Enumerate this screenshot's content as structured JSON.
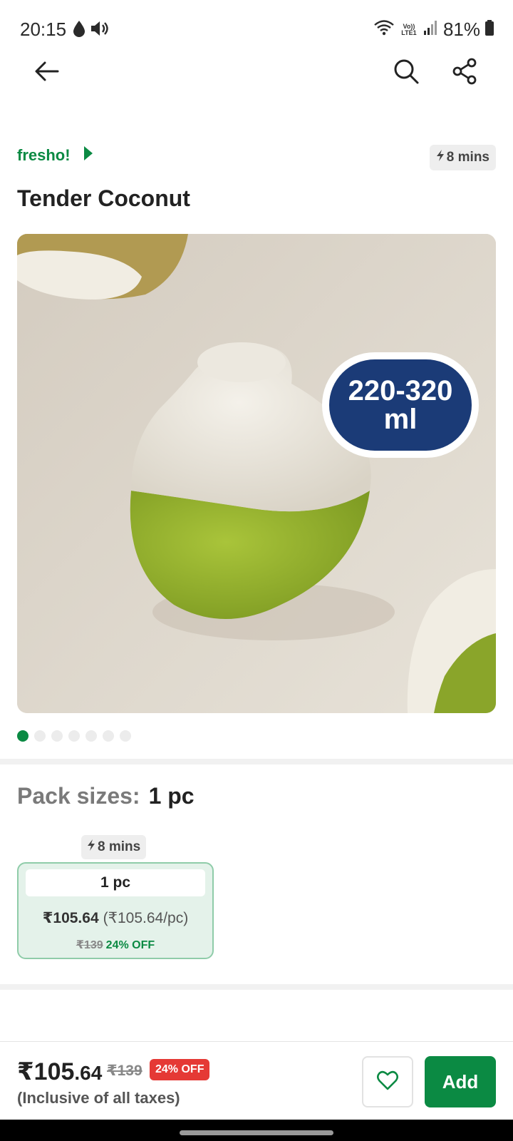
{
  "status_bar": {
    "time": "20:15",
    "battery": "81%",
    "network_label": "Vo)) LTE1",
    "icons": [
      "drop-icon",
      "volume-icon",
      "wifi-icon",
      "signal-icon",
      "battery-icon"
    ]
  },
  "app_bar": {
    "icons": [
      "back-arrow-icon",
      "search-icon",
      "share-icon"
    ]
  },
  "product": {
    "brand": "fresho!",
    "delivery_time": "8 mins",
    "title": "Tender Coconut",
    "image": {
      "volume_badge_line1": "220-320",
      "volume_badge_line2": "ml",
      "badge_color": "#1b3b77",
      "total_images": 7,
      "active_image": 1
    }
  },
  "pack_sizes": {
    "label": "Pack sizes:",
    "selected": "1 pc",
    "options": [
      {
        "delivery_time": "8 mins",
        "size": "1 pc",
        "price": "₹105.64",
        "unit_price": "(₹105.64/pc)",
        "mrp": "₹139",
        "discount": "24% OFF"
      }
    ]
  },
  "bottom_bar": {
    "price_main": "₹105",
    "price_decimal": ".64",
    "mrp": "₹139",
    "discount": "24% OFF",
    "tax_note": "(Inclusive of all taxes)",
    "add_label": "Add"
  },
  "colors": {
    "brand_green": "#0b8a43",
    "discount_red": "#e53935",
    "card_bg": "#e4f2ea"
  }
}
